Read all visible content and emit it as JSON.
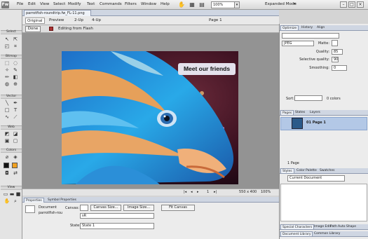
{
  "app": {
    "logo": "Fw",
    "menus": [
      "File",
      "Edit",
      "View",
      "Select",
      "Modify",
      "Text",
      "Commands",
      "Filters",
      "Window",
      "Help"
    ],
    "zoom": "100%",
    "workspace": "Expanded Mode"
  },
  "document": {
    "tab_title": "parrotfish-roundtrip.fw_FL-11.png",
    "views": [
      "Original",
      "Preview",
      "2-Up",
      "4-Up"
    ],
    "active_view": "Original",
    "page_label": "Page 1",
    "done_label": "Done",
    "edit_status": "Editing from Flash"
  },
  "tools": {
    "sections": [
      "Select",
      "Bitmap",
      "Vector",
      "Web",
      "Colors",
      "View"
    ]
  },
  "canvas": {
    "overlay_text": "Meet our friends",
    "status_page": "1",
    "status_size": "550 x 400",
    "status_zoom": "100%"
  },
  "properties": {
    "tabs": [
      "Properties",
      "Symbol Properties"
    ],
    "object_type": "Document",
    "object_name": "parrotfish-rou",
    "canvas_label": "Canvas:",
    "canvas_size_btn": "Canvas Size...",
    "image_size_btn": "Image Size...",
    "fit_canvas_btn": "Fit Canvas",
    "state_label": "State:",
    "state_value": "State 1",
    "value_field": "sR"
  },
  "optimize": {
    "tabs": [
      "Optimize",
      "History",
      "Align"
    ],
    "format": "JPEG",
    "matte_label": "Matte:",
    "quality_label": "Quality:",
    "quality_value": "85",
    "selective_label": "Selective quality:",
    "selective_value": "90",
    "smoothing_label": "Smoothing:",
    "smoothing_value": "0",
    "sort_label": "Sort:",
    "colors_count": "0 colors"
  },
  "pages": {
    "tabs": [
      "Pages",
      "States",
      "Layers"
    ],
    "items": [
      {
        "number": "01",
        "name": "Page 1"
      }
    ],
    "footer": "1 Page"
  },
  "styles": {
    "tabs": [
      "Styles",
      "Color Palette",
      "Swatches"
    ],
    "dropdown": "Current Document"
  },
  "bottom_tabs": {
    "row1": [
      "Special Characters",
      "Image Edit",
      "Path",
      "Auto Shape"
    ],
    "row2": [
      "Document Library",
      "Common Library"
    ]
  },
  "colors": {
    "accent": "#2f6fb3",
    "photo_bg": "#3a0f22"
  }
}
